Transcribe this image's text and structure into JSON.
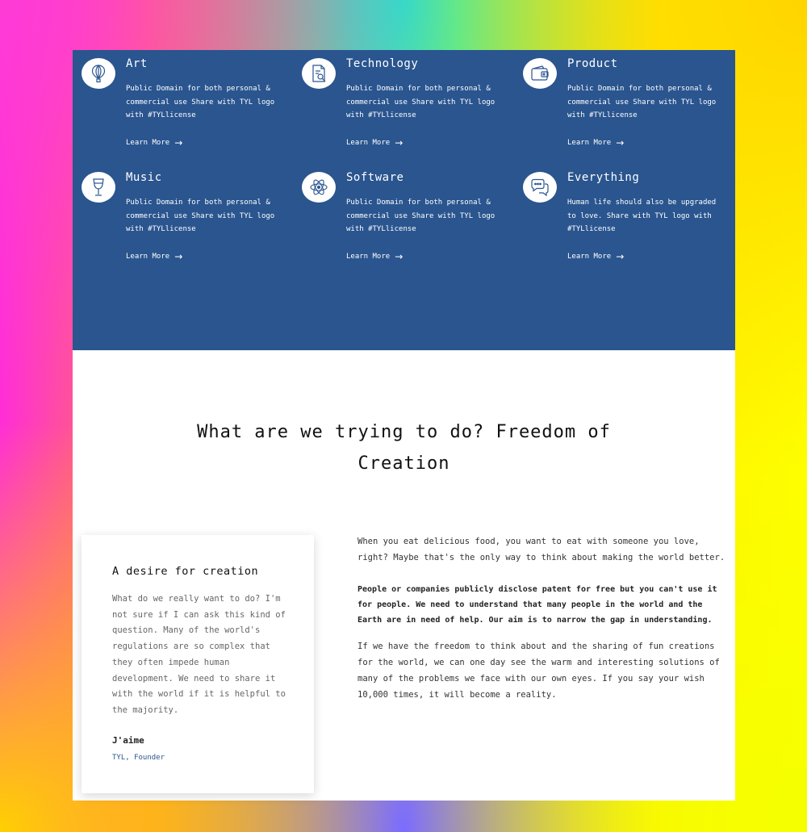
{
  "features": [
    {
      "title": "Art",
      "desc": "Public Domain for both personal & commercial use Share with TYL logo with #TYLlicense",
      "link": "Learn More",
      "icon": "balloon-icon"
    },
    {
      "title": "Technology",
      "desc": "Public Domain for both personal & commercial use Share with TYL logo with #TYLlicense",
      "link": "Learn More",
      "icon": "document-search-icon"
    },
    {
      "title": "Product",
      "desc": "Public Domain for both personal & commercial use Share with TYL logo with #TYLlicense",
      "link": "Learn More",
      "icon": "wallet-icon"
    },
    {
      "title": "Music",
      "desc": "Public Domain for both personal & commercial use Share with TYL logo with #TYLlicense",
      "link": "Learn More",
      "icon": "wine-glass-icon"
    },
    {
      "title": "Software",
      "desc": "Public Domain for both personal & commercial use Share with TYL logo with #TYLlicense",
      "link": "Learn More",
      "icon": "atom-icon"
    },
    {
      "title": "Everything",
      "desc": "Human life should also be upgraded to love. Share with TYL logo with #TYLlicense",
      "link": "Learn More",
      "icon": "chat-bubbles-icon"
    }
  ],
  "section": {
    "heading_line1": "What are we trying to do? Freedom of",
    "heading_line2": "Creation"
  },
  "card": {
    "title": "A desire for creation",
    "body": "What do we really want to do? I'm not sure if I can ask this kind of question. Many of the world's regulations are so complex that they often impede human development. We need to share it with the world if it is helpful to the majority.",
    "author": "J'aime",
    "role": "TYL, Founder"
  },
  "content": {
    "p1": "When you eat delicious food, you want to eat with someone you love, right? Maybe that's the only way to think about making the world better.",
    "p2": "People or companies publicly disclose patent for free but you can't use it for people. We need to understand that many people in the world and the Earth are in need of help. Our aim is to narrow the gap in understanding.",
    "p3": "If we have the freedom to think about and the sharing of fun creations for the world, we can one day see the warm and interesting solutions of many of the problems we face with our own eyes. If you say your wish 10,000 times, it will become a reality."
  },
  "colors": {
    "primary_blue": "#2a558f",
    "white": "#ffffff"
  }
}
